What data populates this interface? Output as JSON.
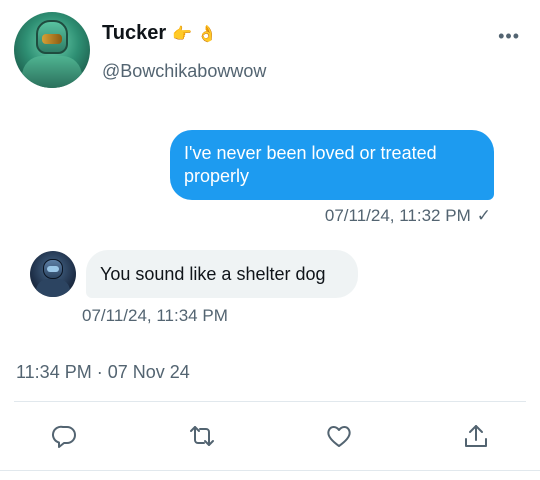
{
  "profile": {
    "name": "Tucker",
    "name_emoji": "👉 👌",
    "handle": "@Bowchikabowwow"
  },
  "menu": {
    "more_label": "•••"
  },
  "messages": [
    {
      "direction": "outgoing",
      "text": "I've never been loved or treated properly",
      "time": "07/11/24, 11:32 PM",
      "status": "✓"
    },
    {
      "direction": "incoming",
      "text": "You sound like a shelter dog",
      "time": "07/11/24, 11:34 PM"
    }
  ],
  "post_timestamp": "11:34 PM · 07 Nov 24",
  "actions": [
    "reply-icon",
    "retweet-icon",
    "like-icon",
    "share-icon"
  ],
  "colors": {
    "accent": "#1d9bf0",
    "incoming_bubble": "#eff3f4",
    "secondary_text": "#536471"
  }
}
